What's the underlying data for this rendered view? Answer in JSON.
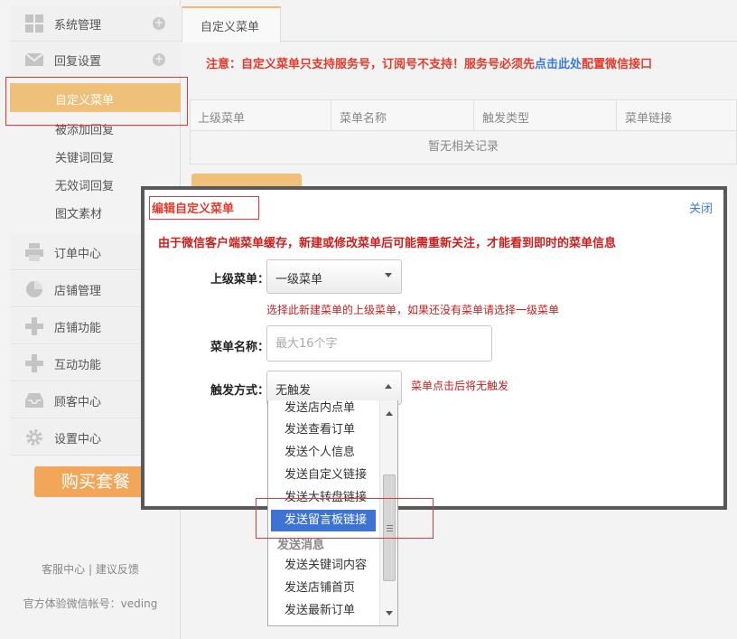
{
  "sidebar": {
    "sections": [
      {
        "label": "系统管理",
        "icon": "grid-icon"
      },
      {
        "label": "回复设置",
        "icon": "mail-icon"
      }
    ],
    "reply_items": [
      "自定义菜单",
      "被添加回复",
      "关键词回复",
      "无效词回复",
      "图文素材"
    ],
    "lower_sections": [
      {
        "label": "订单中心",
        "icon": "printer-icon"
      },
      {
        "label": "店铺管理",
        "icon": "pie-chart-icon"
      },
      {
        "label": "店铺功能",
        "icon": "plus-icon"
      },
      {
        "label": "互动功能",
        "icon": "plus-icon"
      },
      {
        "label": "顾客中心",
        "icon": "inbox-icon"
      },
      {
        "label": "设置中心",
        "icon": "gear-icon"
      }
    ],
    "buy_label": "购买套餐",
    "footer_links": "客服中心 | 建议反馈",
    "footer_account": "官方体验微信帐号：veding"
  },
  "main": {
    "tab_label": "自定义菜单",
    "notice_prefix": "注意：自定义菜单只支持服务号，订阅号不支持！服务号必须先",
    "notice_link": "点击此处",
    "notice_suffix": "配置微信接口",
    "table": {
      "headers": [
        "上级菜单",
        "菜单名称",
        "触发类型",
        "菜单链接"
      ],
      "empty_text": "暂无相关记录"
    }
  },
  "dialog": {
    "title": "编辑自定义菜单",
    "close_label": "关闭",
    "warning": "由于微信客户端菜单缓存，新建或修改菜单后可能需重新关注，才能看到即时的菜单信息",
    "parent_label": "上级菜单：",
    "parent_value": "一级菜单",
    "parent_hint": "选择此新建菜单的上级菜单，如果还没有菜单请选择一级菜单",
    "name_label": "菜单名称：",
    "name_placeholder": "最大16个字",
    "trigger_label": "触发方式：",
    "trigger_value": "无触发",
    "trigger_hint": "菜单点击后将无触发"
  },
  "dropdown": {
    "items_top": [
      "发送店内点单",
      "发送查看订单",
      "发送个人信息",
      "发送自定义链接",
      "发送大转盘链接"
    ],
    "selected": "发送留言板链接",
    "group_label": "发送消息",
    "items_bottom": [
      "发送关键词内容",
      "发送店铺首页",
      "发送最新订单"
    ]
  },
  "colors": {
    "accent": "#efc07a",
    "alert_red": "#e23b2c",
    "link_blue": "#3b7bd4",
    "selection_blue": "#3d74d4"
  }
}
